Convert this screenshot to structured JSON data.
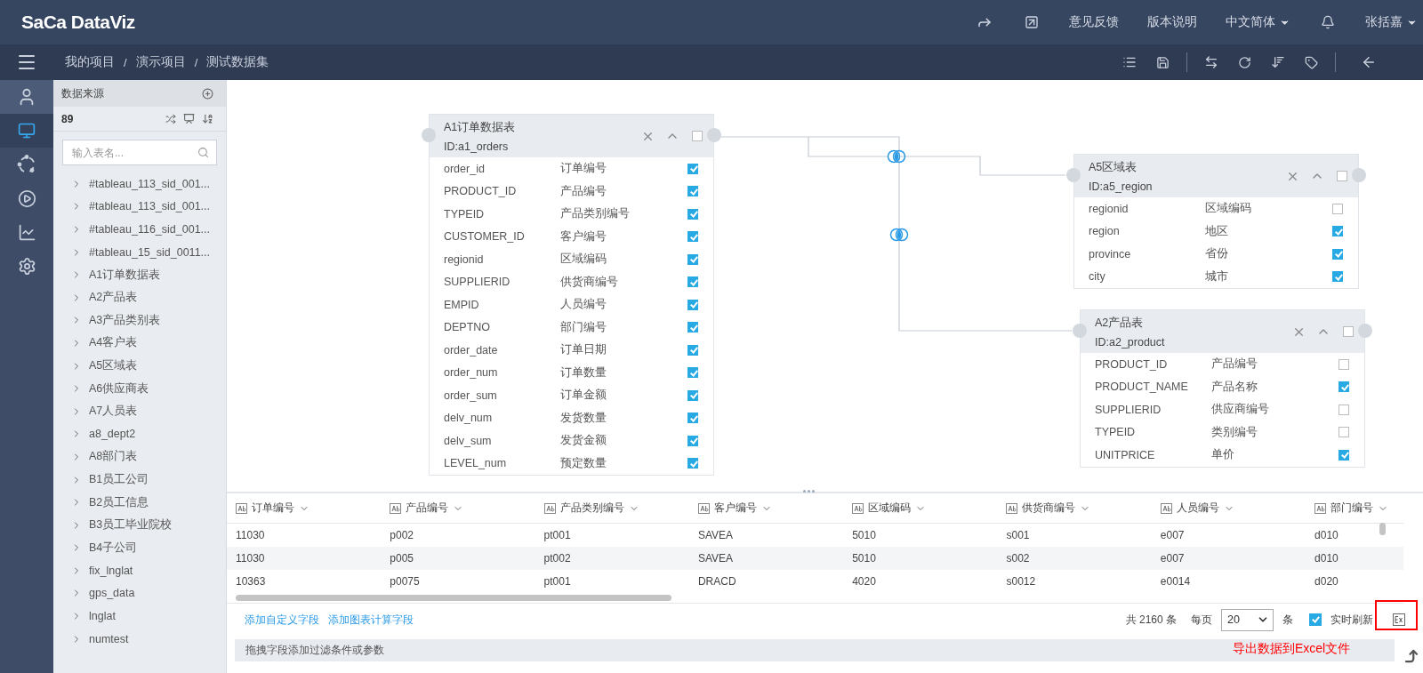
{
  "header": {
    "logo": "SaCa DataViz",
    "links": [
      "意见反馈",
      "版本说明"
    ],
    "language": "中文简体",
    "user": "张括嘉"
  },
  "breadcrumb": [
    "我的项目",
    "演示项目",
    "测试数据集"
  ],
  "breadcrumb_separator": "/",
  "nav": [
    {
      "kind": "user",
      "selected": false,
      "hovered": true
    },
    {
      "kind": "screen",
      "selected": true,
      "hovered": false
    },
    {
      "kind": "cycle",
      "selected": false,
      "hovered": false
    },
    {
      "kind": "play",
      "selected": false,
      "hovered": false
    },
    {
      "kind": "chart",
      "selected": false,
      "hovered": false
    },
    {
      "kind": "settings",
      "selected": false,
      "hovered": false
    }
  ],
  "sidebar": {
    "title": "数据来源",
    "count": "89",
    "search": {
      "placeholder": "输入表名..."
    },
    "items": [
      "#tableau_113_sid_001...",
      "#tableau_113_sid_001...",
      "#tableau_116_sid_001...",
      "#tableau_15_sid_0011...",
      "A1订单数据表",
      "A2产品表",
      "A3产品类别表",
      "A4客户表",
      "A5区域表",
      "A6供应商表",
      "A7人员表",
      "a8_dept2",
      "A8部门表",
      "B1员工公司",
      "B2员工信息",
      "B3员工毕业院校",
      "B4子公司",
      "fix_lnglat",
      "gps_data",
      "lnglat",
      "numtest"
    ]
  },
  "canvas": {
    "nodes": [
      {
        "title": "A1订单数据表",
        "id_text": "ID:a1_orders",
        "checked": false,
        "fields": [
          {
            "name": "order_id",
            "label": "订单编号",
            "checked": true
          },
          {
            "name": "PRODUCT_ID",
            "label": "产品编号",
            "checked": true
          },
          {
            "name": "TYPEID",
            "label": "产品类别编号",
            "checked": true
          },
          {
            "name": "CUSTOMER_ID",
            "label": "客户编号",
            "checked": true
          },
          {
            "name": "regionid",
            "label": "区域编码",
            "checked": true
          },
          {
            "name": "SUPPLIERID",
            "label": "供货商编号",
            "checked": true
          },
          {
            "name": "EMPID",
            "label": "人员编号",
            "checked": true
          },
          {
            "name": "DEPTNO",
            "label": "部门编号",
            "checked": true
          },
          {
            "name": "order_date",
            "label": "订单日期",
            "checked": true
          },
          {
            "name": "order_num",
            "label": "订单数量",
            "checked": true
          },
          {
            "name": "order_sum",
            "label": "订单金额",
            "checked": true
          },
          {
            "name": "delv_num",
            "label": "发货数量",
            "checked": true
          },
          {
            "name": "delv_sum",
            "label": "发货金额",
            "checked": true
          },
          {
            "name": "LEVEL_num",
            "label": "预定数量",
            "checked": true
          }
        ]
      },
      {
        "title": "A5区域表",
        "id_text": "ID:a5_region",
        "checked": false,
        "fields": [
          {
            "name": "regionid",
            "label": "区域编码",
            "checked": false
          },
          {
            "name": "region",
            "label": "地区",
            "checked": true
          },
          {
            "name": "province",
            "label": "省份",
            "checked": true
          },
          {
            "name": "city",
            "label": "城市",
            "checked": true
          }
        ]
      },
      {
        "title": "A2产品表",
        "id_text": "ID:a2_product",
        "checked": false,
        "fields": [
          {
            "name": "PRODUCT_ID",
            "label": "产品编号",
            "checked": false
          },
          {
            "name": "PRODUCT_NAME",
            "label": "产品名称",
            "checked": true
          },
          {
            "name": "SUPPLIERID",
            "label": "供应商编号",
            "checked": false
          },
          {
            "name": "TYPEID",
            "label": "类别编号",
            "checked": false
          },
          {
            "name": "UNITPRICE",
            "label": "单价",
            "checked": true
          }
        ]
      }
    ]
  },
  "grid": {
    "columns": [
      "订单编号",
      "产品编号",
      "产品类别编号",
      "客户编号",
      "区域编码",
      "供货商编号",
      "人员编号",
      "部门编号"
    ],
    "rows": [
      [
        "11030",
        "p002",
        "pt001",
        "SAVEA",
        "5010",
        "s001",
        "e007",
        "d010"
      ],
      [
        "11030",
        "p005",
        "pt002",
        "SAVEA",
        "5010",
        "s002",
        "e007",
        "d010"
      ],
      [
        "10363",
        "p0075",
        "pt001",
        "DRACD",
        "4020",
        "s0012",
        "e0014",
        "d020"
      ]
    ]
  },
  "footer": {
    "links": [
      "添加自定义字段",
      "添加图表计算字段"
    ],
    "total": "共 2160 条",
    "per_page_label": "每页",
    "page_size": "20",
    "unit": "条",
    "realtime": {
      "label": "实时刷新",
      "checked": true
    }
  },
  "filter_bar": {
    "placeholder": "拖拽字段添加过滤条件或参数"
  },
  "annotation": {
    "text": "导出数据到Excel文件"
  }
}
